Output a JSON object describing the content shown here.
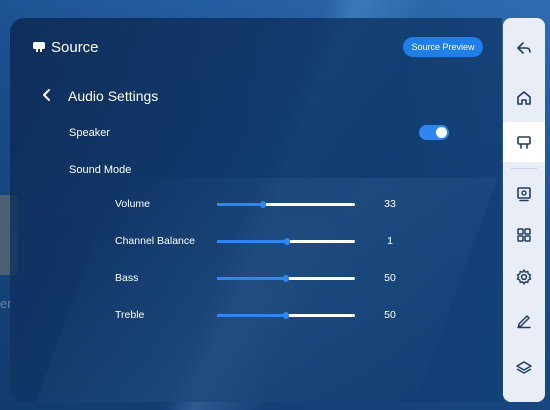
{
  "colors": {
    "accent": "#1f7ee8",
    "track": "#ffffff",
    "rail": "#e9eef6",
    "rail_icon": "#1f3c63"
  },
  "header": {
    "icon": "source-icon",
    "title": "Source",
    "preview_button": "Source Preview"
  },
  "audio_settings": {
    "back_icon": "chevron-left-icon",
    "title": "Audio Settings",
    "speaker": {
      "label": "Speaker",
      "enabled": true
    },
    "sound_mode": {
      "label": "Sound Mode"
    },
    "sliders": [
      {
        "label": "Volume",
        "value": "33",
        "fill_fraction": 0.33
      },
      {
        "label": "Channel Balance",
        "value": "1",
        "fill_fraction": 0.51
      },
      {
        "label": "Bass",
        "value": "50",
        "fill_fraction": 0.5
      },
      {
        "label": "Treble",
        "value": "50",
        "fill_fraction": 0.5
      }
    ]
  },
  "background": {
    "partial_text": "er"
  },
  "sidebar": {
    "items": [
      {
        "name": "back",
        "icon": "back-icon"
      },
      {
        "name": "home",
        "icon": "home-icon"
      },
      {
        "name": "source",
        "icon": "source-icon",
        "active": true
      },
      {
        "name": "screen",
        "icon": "screen-icon"
      },
      {
        "name": "apps",
        "icon": "grid-icon"
      },
      {
        "name": "settings",
        "icon": "gear-icon"
      },
      {
        "name": "annotate",
        "icon": "pen-icon"
      },
      {
        "name": "layers",
        "icon": "layers-icon"
      }
    ]
  }
}
